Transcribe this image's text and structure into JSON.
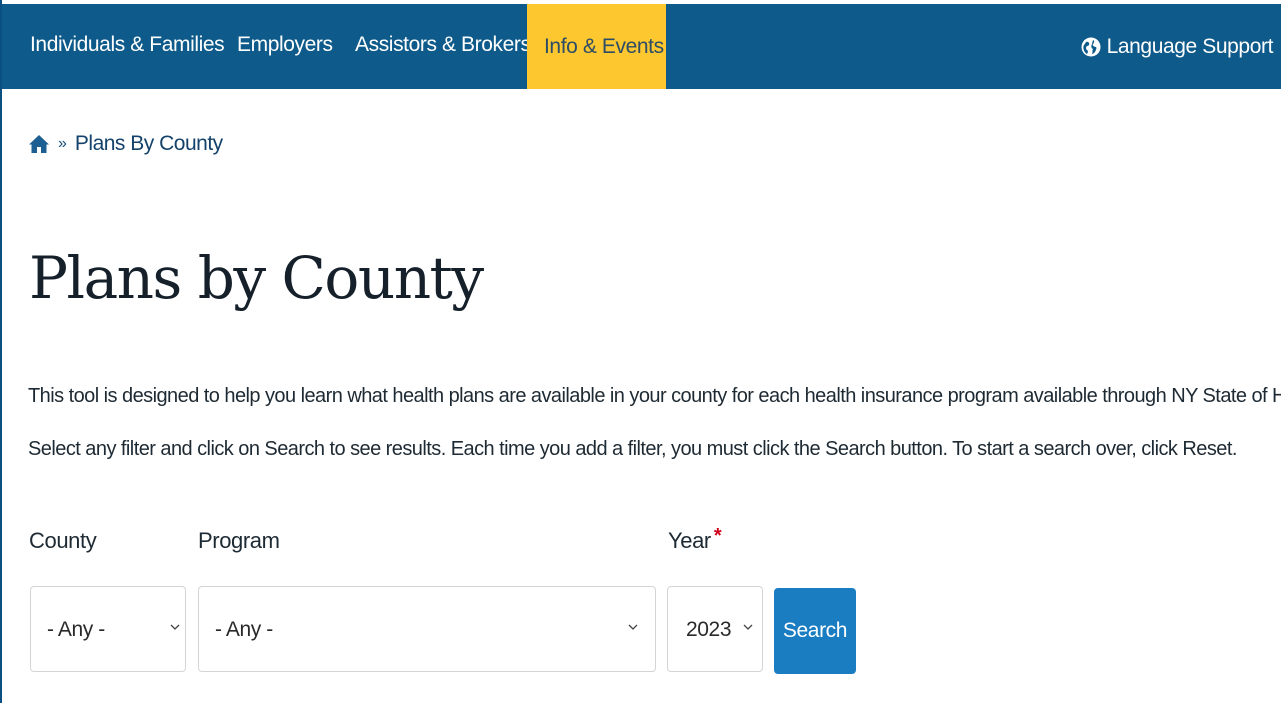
{
  "nav": {
    "items": [
      {
        "label": "Individuals & Families"
      },
      {
        "label": "Employers"
      },
      {
        "label": "Assistors & Brokers"
      },
      {
        "label": "Info & Events"
      }
    ],
    "active_index": 3,
    "language_support": "Language Support",
    "colors": {
      "bar": "#0e5a8a",
      "active": "#fcc72f"
    }
  },
  "breadcrumb": {
    "home_icon": "home-icon",
    "separator": "»",
    "current": "Plans By County"
  },
  "page": {
    "title": "Plans by County",
    "description_line1": "This tool is designed to help you learn what health plans are available in your county for each health insurance program available through NY State of Health.",
    "description_line2": "Select any filter and click on Search to see results. Each time you add a filter, you must click the Search button. To start a search over, click Reset."
  },
  "filters": {
    "county": {
      "label": "County",
      "value": "- Any -"
    },
    "program": {
      "label": "Program",
      "value": "- Any -"
    },
    "year": {
      "label": "Year",
      "required_mark": "*",
      "value": "2023"
    },
    "search_label": "Search"
  }
}
